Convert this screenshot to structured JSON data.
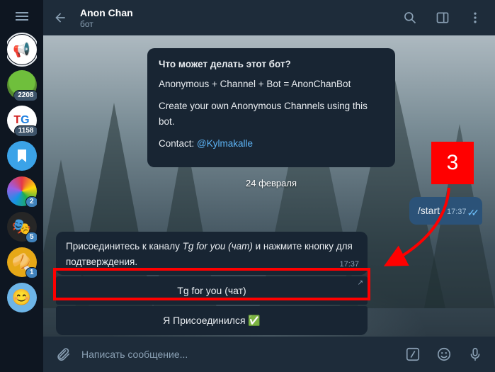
{
  "header": {
    "title": "Anon Chan",
    "subtitle": "бот"
  },
  "sidebar": {
    "items": [
      {
        "id": "megaphone",
        "badge": null
      },
      {
        "id": "android",
        "badge": "2208"
      },
      {
        "id": "tg",
        "badge": "1158"
      },
      {
        "id": "bookmark",
        "badge": null
      },
      {
        "id": "color",
        "badge": "2",
        "blue": true
      },
      {
        "id": "mask",
        "badge": "5",
        "blue": true
      },
      {
        "id": "cookie",
        "badge": "1",
        "blue": true
      },
      {
        "id": "last",
        "badge": null
      }
    ]
  },
  "botInfo": {
    "heading": "Что может делать этот бот?",
    "line1": "Anonymous + Channel + Bot = AnonChanBot",
    "line2": "Create your own Anonymous Channels using this bot.",
    "contact_label": "Contact: ",
    "contact_handle": "@Kylmakalle"
  },
  "dateSeparator": "24 февраля",
  "outgoing": {
    "text": "/start",
    "time": "17:37"
  },
  "incoming": {
    "text_pre": "Присоединитесь к каналу ",
    "text_em": "Tg for you (чат)",
    "text_post": " и нажмите кнопку для подтверждения.",
    "time": "17:37",
    "buttons": {
      "b1": "Tg for you (чат)",
      "b2": "Я Присоединился ✅"
    }
  },
  "composer": {
    "placeholder": "Написать сообщение..."
  },
  "annotation": {
    "number": "3"
  }
}
